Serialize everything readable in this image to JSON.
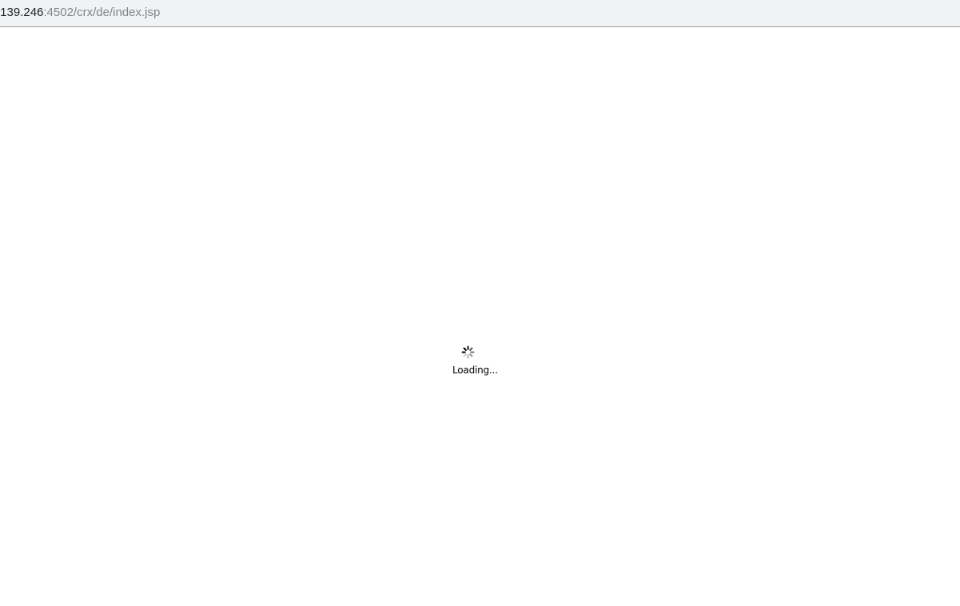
{
  "browser": {
    "url_host": ".139.246",
    "url_path": ":4502/crx/de/index.jsp"
  },
  "loader": {
    "icon": "spinner-icon",
    "text": "Loading..."
  },
  "colors": {
    "address_bar_bg": "#f1f2f4",
    "url_host": "#202124",
    "url_path": "#80868b",
    "page_bg": "#ffffff"
  }
}
